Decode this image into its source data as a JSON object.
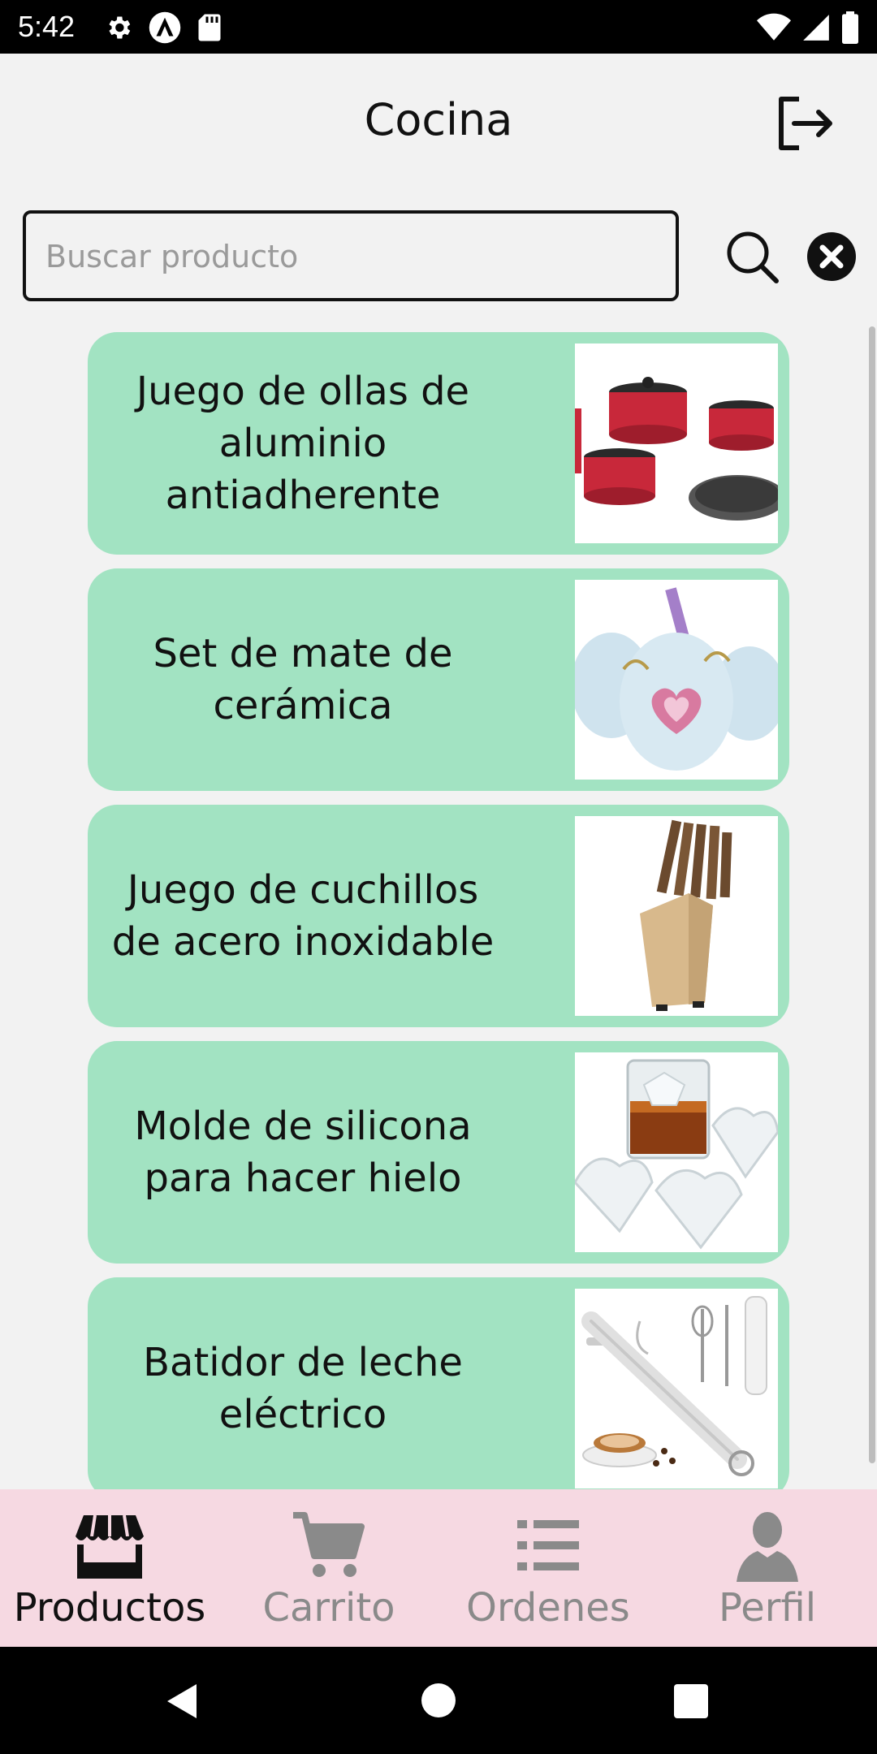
{
  "status_bar": {
    "time": "5:42"
  },
  "header": {
    "title": "Cocina"
  },
  "search": {
    "placeholder": "Buscar producto",
    "value": ""
  },
  "products": [
    {
      "name": "Juego de ollas de aluminio antiadherente",
      "image": "red-pots-set"
    },
    {
      "name": "Set de mate de cerámica",
      "image": "ceramic-mate-set"
    },
    {
      "name": "Juego de cuchillos de acero inoxidable",
      "image": "knife-block"
    },
    {
      "name": "Molde de silicona para hacer hielo",
      "image": "heart-ice-cubes"
    },
    {
      "name": "Batidor de leche eléctrico",
      "image": "milk-frother"
    }
  ],
  "bottom_nav": {
    "items": [
      {
        "label": "Productos",
        "icon": "storefront-icon",
        "active": true
      },
      {
        "label": "Carrito",
        "icon": "cart-icon",
        "active": false
      },
      {
        "label": "Ordenes",
        "icon": "list-icon",
        "active": false
      },
      {
        "label": "Perfil",
        "icon": "person-icon",
        "active": false
      }
    ]
  },
  "colors": {
    "card": "#a2e3c2",
    "bottom_nav": "#f6d9e2",
    "nav_active": "#111111",
    "nav_inactive": "#8a8a8a"
  }
}
